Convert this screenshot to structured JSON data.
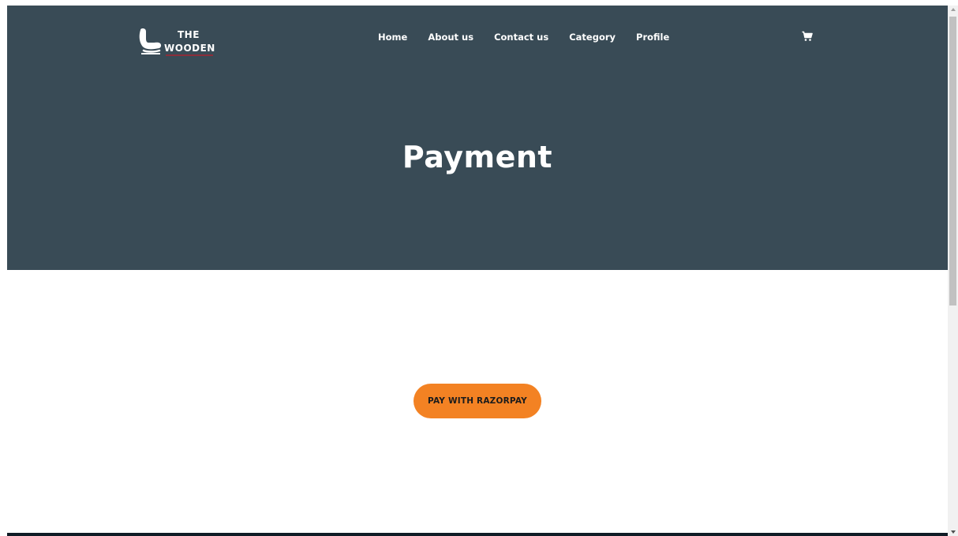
{
  "brand": {
    "logo_line1": "THE",
    "logo_line2": "WOODEN",
    "logo_icon": "armchair-icon"
  },
  "nav": {
    "items": [
      {
        "label": "Home"
      },
      {
        "label": "About us"
      },
      {
        "label": "Contact us"
      },
      {
        "label": "Category"
      },
      {
        "label": "Profile"
      }
    ],
    "cart_icon": "cart-icon"
  },
  "hero": {
    "title": "Payment"
  },
  "payment": {
    "button_label": "PAY WITH RAZORPAY"
  },
  "colors": {
    "hero_background": "#394b56",
    "button_background": "#f38223",
    "footer_strip": "#0f1c26",
    "logo_accent": "#8b2e3a"
  }
}
